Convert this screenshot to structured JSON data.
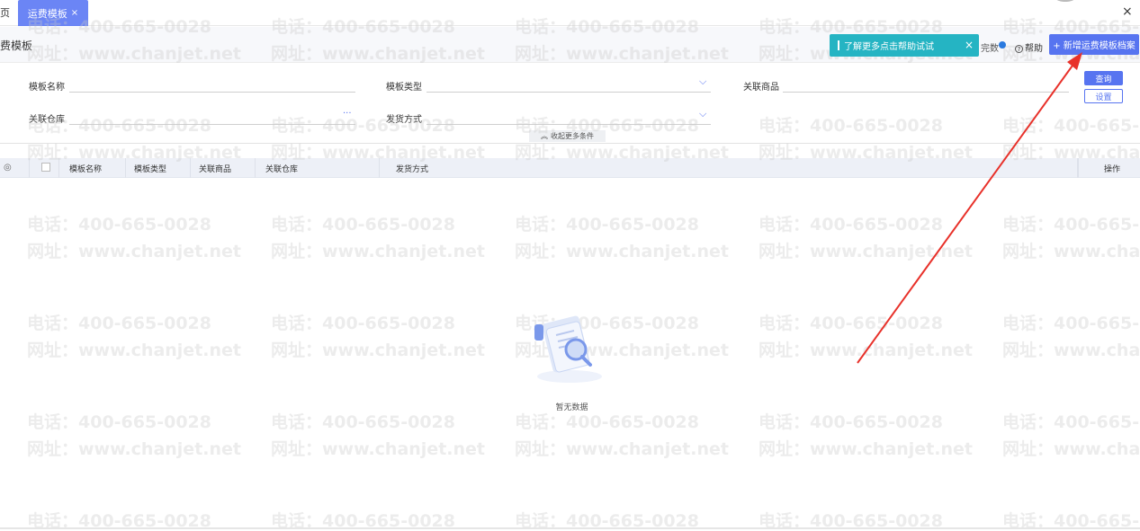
{
  "tabs": {
    "home": "页",
    "active": "运费模板",
    "close_symbol": "×"
  },
  "window": {
    "close_symbol": "×"
  },
  "page": {
    "title": "费模板"
  },
  "help_tip": {
    "text": "了解更多点击帮助试试",
    "close_symbol": "×"
  },
  "toolbar": {
    "switch_label": "完数",
    "help_label": "帮助",
    "help_icon": "?",
    "add_button": "+ 新增运费模板档案"
  },
  "filters": {
    "template_name_label": "模板名称",
    "template_type_label": "模板类型",
    "related_goods_label": "关联商品",
    "related_warehouse_label": "关联仓库",
    "delivery_method_label": "发货方式",
    "more_symbol": "···",
    "chevron_symbol": "⌵",
    "query_button": "查询",
    "settings_button": "设置",
    "collapse_label": "收起更多条件",
    "collapse_icon": "︽"
  },
  "table": {
    "columns": [
      "模板名称",
      "模板类型",
      "关联商品",
      "关联仓库",
      "发货方式"
    ],
    "actions_header": "操作",
    "gear_icon": "◎",
    "empty_text": "暂无数据"
  },
  "watermark": {
    "phone": "电话：400-665-0028",
    "site": "网址：www.chanjet.net"
  },
  "colors": {
    "primary": "#5774f0",
    "tab_active": "#6b85f5",
    "tip": "#25b4c3",
    "arrow": "#e8312a"
  },
  "icons": {
    "empty": "empty-document-magnifier-icon",
    "gear": "gear-icon",
    "arrow": "red-arrow-annotation"
  }
}
